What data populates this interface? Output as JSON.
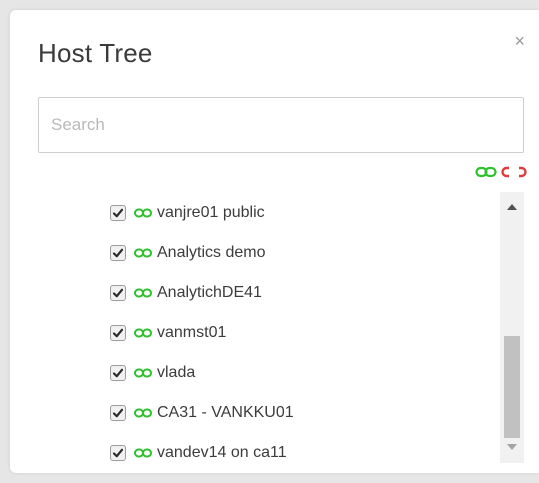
{
  "dialog": {
    "title": "Host Tree",
    "close_label": "×"
  },
  "search": {
    "placeholder": "Search",
    "value": ""
  },
  "toolbar": {
    "icons": [
      "link-all-icon",
      "unlink-all-icon"
    ],
    "link_color": "#2fbf2f",
    "unlink_color": "#e03a3a"
  },
  "tree": {
    "items": [
      {
        "label": "vanjre01 public",
        "checked": true,
        "status_icon": "link-icon"
      },
      {
        "label": "Analytics demo",
        "checked": true,
        "status_icon": "link-icon"
      },
      {
        "label": "AnalytichDE41",
        "checked": true,
        "status_icon": "link-icon"
      },
      {
        "label": "vanmst01",
        "checked": true,
        "status_icon": "link-icon"
      },
      {
        "label": "vlada",
        "checked": true,
        "status_icon": "link-icon"
      },
      {
        "label": "CA31 - VANKKU01",
        "checked": true,
        "status_icon": "link-icon"
      },
      {
        "label": "vandev14 on ca11",
        "checked": true,
        "status_icon": "link-icon"
      }
    ]
  }
}
